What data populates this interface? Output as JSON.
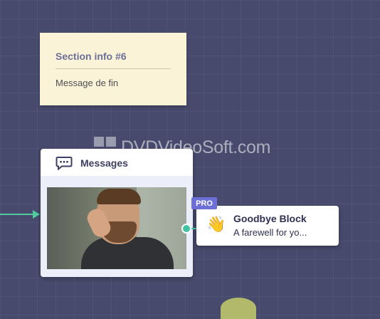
{
  "note": {
    "title": "Section info #6",
    "text": "Message de fin",
    "color": "#fbf3d7"
  },
  "watermark": {
    "text": "DVDVideoSoft.com"
  },
  "messages_block": {
    "title": "Messages",
    "icon": "chat-bubble-icon",
    "gif_description_icon": "animated-gif"
  },
  "goodbye_block": {
    "badge": "PRO",
    "title": "Goodbye Block",
    "description": "A farewell for yo...",
    "icon": "waving-hand-icon",
    "badge_color": "#6d6fd8"
  },
  "colors": {
    "canvas": "#474a6c",
    "connector": "#3fc3a0"
  }
}
